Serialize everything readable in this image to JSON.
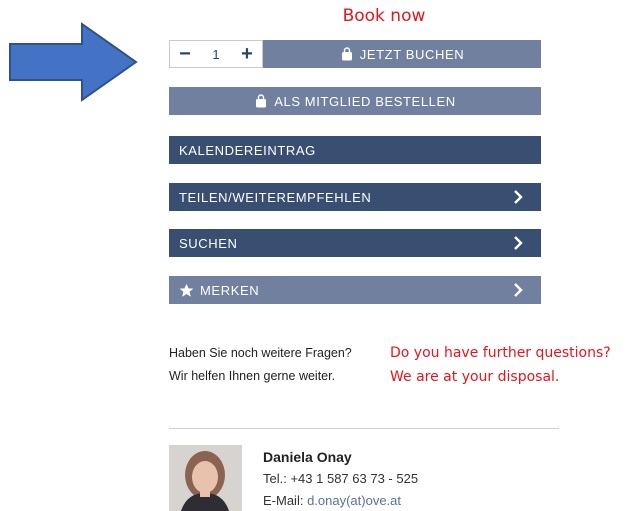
{
  "annotations": {
    "book_now": "Book now",
    "further_questions_en": "Do you have further questions?",
    "at_disposal_en": "We are at your disposal.",
    "arrow_icon": "right-arrow-icon",
    "arrow_color": "#4472c4"
  },
  "quantity": {
    "minus": "−",
    "value": "1",
    "plus": "+"
  },
  "buttons": {
    "jetzt_buchen": "JETZT BUCHEN",
    "als_mitglied": "ALS MITGLIED BESTELLEN",
    "kalendereintrag": "KALENDEREINTRAG",
    "teilen": "TEILEN/WEITEREMPFEHLEN",
    "suchen": "SUCHEN",
    "merken": "MERKEN"
  },
  "help": {
    "line1": "Haben Sie noch weitere Fragen?",
    "line2": "Wir helfen Ihnen gerne weiter."
  },
  "contact": {
    "name": "Daniela Onay",
    "tel_label": "Tel.: ",
    "tel": "+43 1 587 63 73 - 525",
    "email_label": "E-Mail: ",
    "email": "d.onay(at)ove.at"
  },
  "colors": {
    "light_button": "#7280a0",
    "dark_button": "#394f72",
    "annotation_red": "#e8141c"
  }
}
